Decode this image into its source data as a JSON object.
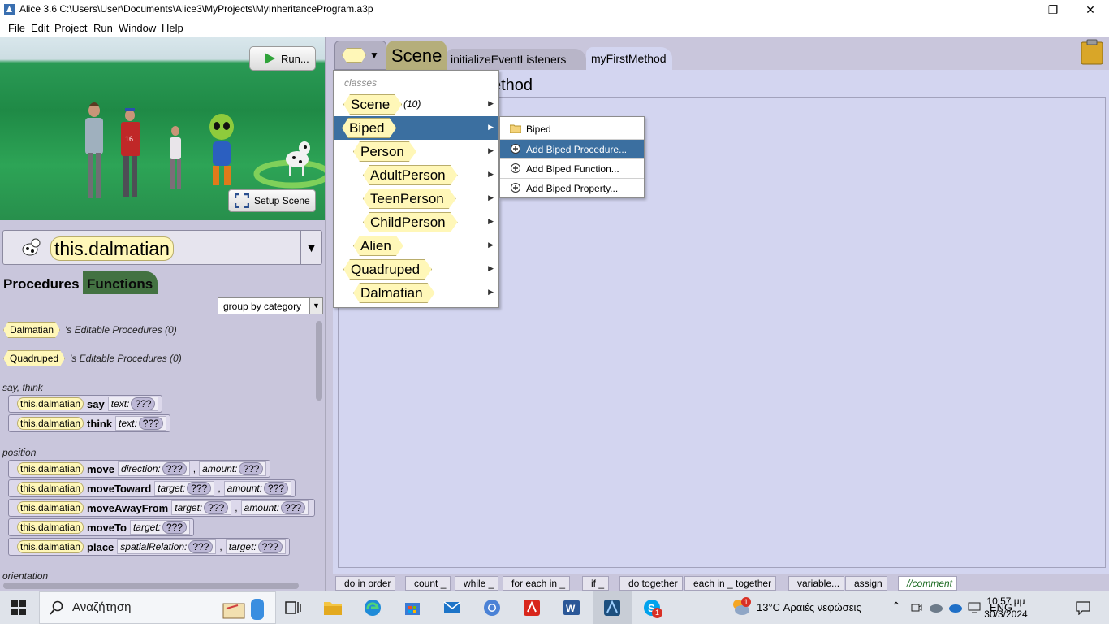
{
  "window": {
    "title": "Alice 3.6 C:\\Users\\User\\Documents\\Alice3\\MyProjects\\MyInheritanceProgram.a3p",
    "minimize_glyph": "—",
    "maximize_glyph": "❐",
    "close_glyph": "✕"
  },
  "menubar": [
    "File",
    "Edit",
    "Project",
    "Run",
    "Window",
    "Help"
  ],
  "scene_view": {
    "run_label": "Run...",
    "setup_label": "Setup Scene"
  },
  "object_selector": {
    "value": "this.dalmatian"
  },
  "panel_tabs": {
    "procedures": "Procedures",
    "functions": "Functions"
  },
  "group_by": {
    "value": "group by category"
  },
  "editable_groups": [
    {
      "class_name": "Dalmatian",
      "suffix": "'s Editable Procedures (0)"
    },
    {
      "class_name": "Quadruped",
      "suffix": "'s Editable Procedures (0)"
    }
  ],
  "categories": {
    "say_think": "say, think",
    "position": "position",
    "orientation": "orientation"
  },
  "procedures": [
    {
      "target": "this.dalmatian",
      "method": "say",
      "params": [
        {
          "name": "text:",
          "value": "???"
        }
      ]
    },
    {
      "target": "this.dalmatian",
      "method": "think",
      "params": [
        {
          "name": "text:",
          "value": "???"
        }
      ]
    },
    {
      "target": "this.dalmatian",
      "method": "move",
      "params": [
        {
          "name": "direction:",
          "value": "???"
        },
        {
          "name": "amount:",
          "value": "???"
        }
      ]
    },
    {
      "target": "this.dalmatian",
      "method": "moveToward",
      "params": [
        {
          "name": "target:",
          "value": "???"
        },
        {
          "name": "amount:",
          "value": "???"
        }
      ]
    },
    {
      "target": "this.dalmatian",
      "method": "moveAwayFrom",
      "params": [
        {
          "name": "target:",
          "value": "???"
        },
        {
          "name": "amount:",
          "value": "???"
        }
      ]
    },
    {
      "target": "this.dalmatian",
      "method": "moveTo",
      "params": [
        {
          "name": "target:",
          "value": "???"
        }
      ]
    },
    {
      "target": "this.dalmatian",
      "method": "place",
      "params": [
        {
          "name": "spatialRelation:",
          "value": "???"
        },
        {
          "name": "target:",
          "value": "???"
        }
      ]
    }
  ],
  "editor_tabs": {
    "scene": "Scene",
    "init": "initializeEventListeners",
    "first": "myFirstMethod"
  },
  "method_title": "ethod",
  "class_menu": {
    "header": "classes",
    "items": [
      {
        "label": "Scene",
        "count": "(10)"
      },
      {
        "label": "Biped"
      },
      {
        "label": "Person"
      },
      {
        "label": "AdultPerson"
      },
      {
        "label": "TeenPerson"
      },
      {
        "label": "ChildPerson"
      },
      {
        "label": "Alien"
      },
      {
        "label": "Quadruped"
      },
      {
        "label": "Dalmatian"
      }
    ]
  },
  "biped_submenu": [
    {
      "label": "Biped"
    },
    {
      "label": "Add Biped Procedure..."
    },
    {
      "label": "Add Biped Function..."
    },
    {
      "label": "Add Biped Property..."
    }
  ],
  "control_bar": [
    "do in order",
    "count _",
    "while _",
    "for each in _",
    "if _",
    "do together",
    "each in _ together",
    "variable...",
    "assign",
    "//comment"
  ],
  "taskbar": {
    "search_placeholder": "Αναζήτηση",
    "weather": "13°C  Αραιές νεφώσεις",
    "lang": "ENG",
    "time": "10:57 μμ",
    "date": "30/3/2024",
    "weather_badge": "1",
    "skype_badge": "1"
  }
}
